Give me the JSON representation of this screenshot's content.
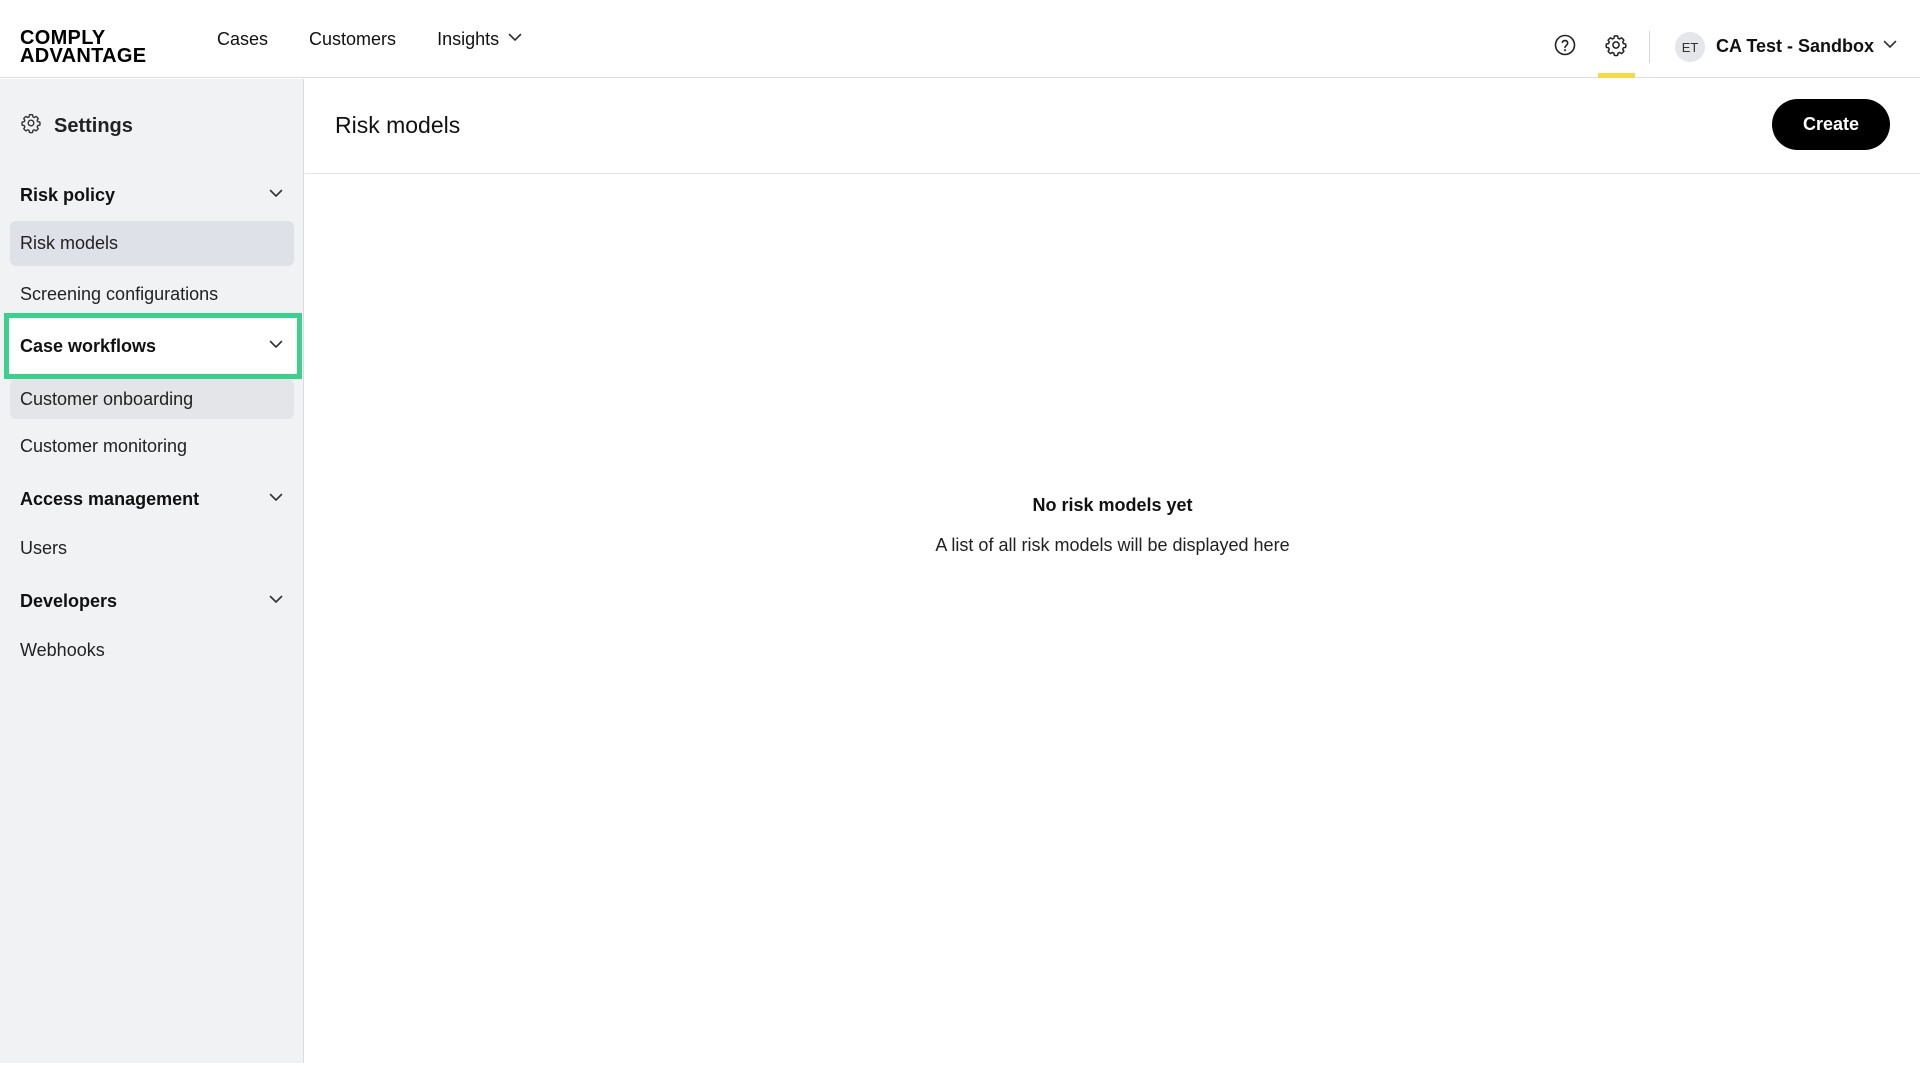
{
  "brand": {
    "line1": "COMPLY",
    "line2": "ADVANTAGE"
  },
  "nav": {
    "cases": "Cases",
    "customers": "Customers",
    "insights": "Insights"
  },
  "account": {
    "initials": "ET",
    "name": "CA Test - Sandbox"
  },
  "sidebar": {
    "title": "Settings",
    "sections": {
      "risk_policy": "Risk policy",
      "case_workflows": "Case workflows",
      "access_management": "Access management",
      "developers": "Developers"
    },
    "items": {
      "risk_models": "Risk models",
      "screening_configurations": "Screening configurations",
      "customer_onboarding": "Customer onboarding",
      "customer_monitoring": "Customer monitoring",
      "users": "Users",
      "webhooks": "Webhooks"
    }
  },
  "main": {
    "title": "Risk models",
    "create_label": "Create",
    "empty_title": "No risk models yet",
    "empty_subtitle": "A list of all risk models will be displayed here"
  },
  "colors": {
    "highlight": "#3ccf8e",
    "settings_indicator": "#f2d94e",
    "primary_button": "#000000"
  },
  "icons": [
    "help-icon",
    "gear-icon",
    "chevron-down-icon"
  ]
}
